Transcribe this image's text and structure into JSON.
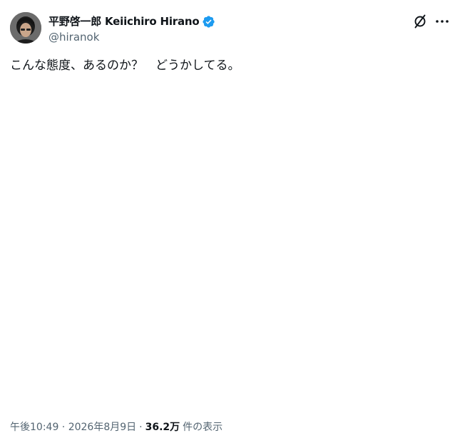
{
  "author": {
    "display_name": "平野啓一郎 Keiichiro Hirano",
    "handle": "@hiranok",
    "verified_icon": "verified-badge-icon",
    "avatar_icon": "avatar"
  },
  "actions": {
    "grok_icon": "grok-icon",
    "more_icon": "more-icon"
  },
  "tweet": {
    "text": "こんな態度、あるのか？　どうかしてる。"
  },
  "meta": {
    "timestamp": "午後10:49 · 2026年8月9日",
    "separator": "·",
    "views_count": "36.2万",
    "views_label": "件の表示"
  },
  "colors": {
    "text": "#0f1419",
    "secondary": "#536471",
    "verified": "#1d9bf0"
  }
}
